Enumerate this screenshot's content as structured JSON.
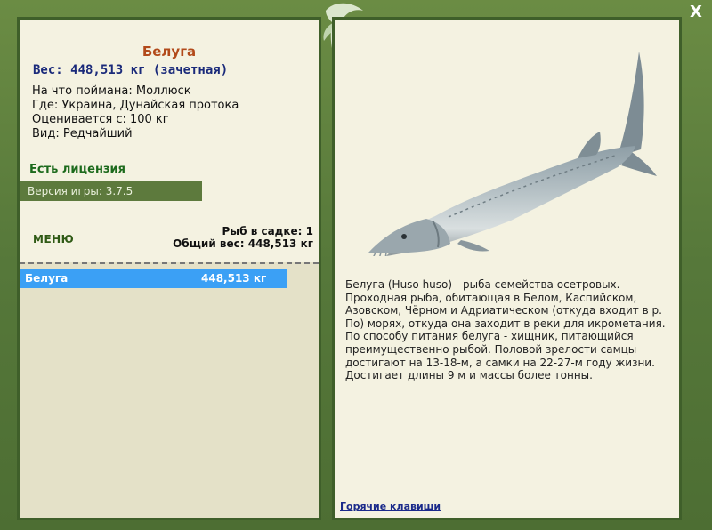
{
  "fish": {
    "name": "Белуга",
    "weight_line": "Вес: 448,513 кг (зачетная)",
    "caught_on": "На что поймана: Моллюск",
    "location": "Где: Украина, Дунайская протока",
    "valued_from": "Оценивается с: 100 кг",
    "species": "Вид: Редчайший"
  },
  "license": "Есть лицензия",
  "version": "Версия игры: 3.7.5",
  "menu_label": "МЕНЮ",
  "cage": {
    "count_line": "Рыб в садке: 1",
    "total_line": "Общий вес: 448,513 кг"
  },
  "catch_list": [
    {
      "name": "Белуга",
      "weight": "448,513 кг"
    }
  ],
  "description": "Белуга (Huso huso) - рыба семейства осетровых. Проходная рыба, обитающая в Белом, Каспийском, Азовском, Чёрном и Адриатическом (откуда входит в р. По) морях, откуда она заходит в реки для икрометания. По способу питания белуга - хищник, питающийся преимущественно рыбой. Половой зрелости самцы достигают на 13-18-м, а самки на 22-27-м году жизни. Достигает длины 9 м и массы более тонны.",
  "hotkeys_link": "Горячие клавиши",
  "close_glyph": "X",
  "colors": {
    "title": "#b24a1a",
    "weight": "#1a2a7a",
    "license": "#1c6a1c",
    "selected_row": "#3ba0f5",
    "frame": "#56783a"
  }
}
